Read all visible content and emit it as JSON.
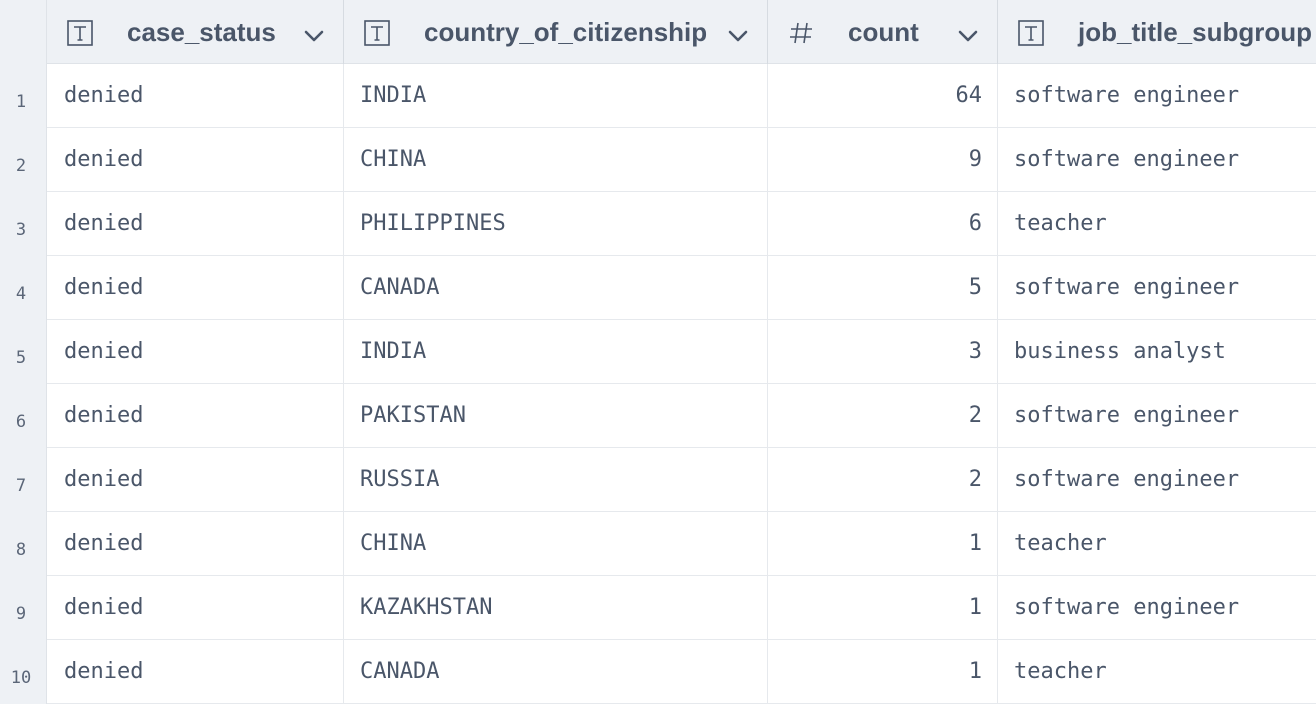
{
  "table": {
    "columns": [
      {
        "name": "case_status",
        "type_icon": "text-type-icon",
        "type_glyph": "T"
      },
      {
        "name": "country_of_citizenship",
        "type_icon": "text-type-icon",
        "type_glyph": "T"
      },
      {
        "name": "count",
        "type_icon": "number-type-icon",
        "type_glyph": "#"
      },
      {
        "name": "job_title_subgroup",
        "type_icon": "text-type-icon",
        "type_glyph": "T"
      }
    ],
    "rows": [
      {
        "num": "1",
        "case_status": "denied",
        "country": "INDIA",
        "count": "64",
        "job": "software engineer"
      },
      {
        "num": "2",
        "case_status": "denied",
        "country": "CHINA",
        "count": "9",
        "job": "software engineer"
      },
      {
        "num": "3",
        "case_status": "denied",
        "country": "PHILIPPINES",
        "count": "6",
        "job": "teacher"
      },
      {
        "num": "4",
        "case_status": "denied",
        "country": "CANADA",
        "count": "5",
        "job": "software engineer"
      },
      {
        "num": "5",
        "case_status": "denied",
        "country": "INDIA",
        "count": "3",
        "job": "business analyst"
      },
      {
        "num": "6",
        "case_status": "denied",
        "country": "PAKISTAN",
        "count": "2",
        "job": "software engineer"
      },
      {
        "num": "7",
        "case_status": "denied",
        "country": "RUSSIA",
        "count": "2",
        "job": "software engineer"
      },
      {
        "num": "8",
        "case_status": "denied",
        "country": "CHINA",
        "count": "1",
        "job": "teacher"
      },
      {
        "num": "9",
        "case_status": "denied",
        "country": "KAZAKHSTAN",
        "count": "1",
        "job": "software engineer"
      },
      {
        "num": "10",
        "case_status": "denied",
        "country": "CANADA",
        "count": "1",
        "job": "teacher"
      }
    ]
  },
  "colors": {
    "header_bg": "#eef1f5",
    "text": "#4a5669",
    "border": "#e6e9ed"
  }
}
